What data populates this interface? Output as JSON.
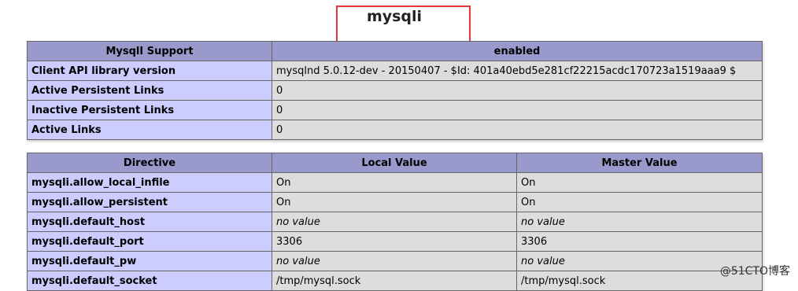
{
  "title": "mysqli",
  "support_table": {
    "headers": [
      "MysqlI Support",
      "enabled"
    ],
    "rows": [
      {
        "name": "Client API library version",
        "value": "mysqlnd 5.0.12-dev - 20150407 - $Id: 401a40ebd5e281cf22215acdc170723a1519aaa9 $"
      },
      {
        "name": "Active Persistent Links",
        "value": "0"
      },
      {
        "name": "Inactive Persistent Links",
        "value": "0"
      },
      {
        "name": "Active Links",
        "value": "0"
      }
    ]
  },
  "directive_table": {
    "headers": [
      "Directive",
      "Local Value",
      "Master Value"
    ],
    "rows": [
      {
        "name": "mysqli.allow_local_infile",
        "local": "On",
        "master": "On",
        "novalue": false
      },
      {
        "name": "mysqli.allow_persistent",
        "local": "On",
        "master": "On",
        "novalue": false
      },
      {
        "name": "mysqli.default_host",
        "local": "no value",
        "master": "no value",
        "novalue": true
      },
      {
        "name": "mysqli.default_port",
        "local": "3306",
        "master": "3306",
        "novalue": false
      },
      {
        "name": "mysqli.default_pw",
        "local": "no value",
        "master": "no value",
        "novalue": true
      },
      {
        "name": "mysqli.default_socket",
        "local": "/tmp/mysql.sock",
        "master": "/tmp/mysql.sock",
        "novalue": false
      }
    ]
  },
  "watermark": "@51CTO博客",
  "colors": {
    "header_bg": "#9999cc",
    "label_bg": "#ccccff",
    "value_bg": "#dddddd",
    "highlight": "#e03a3a"
  }
}
